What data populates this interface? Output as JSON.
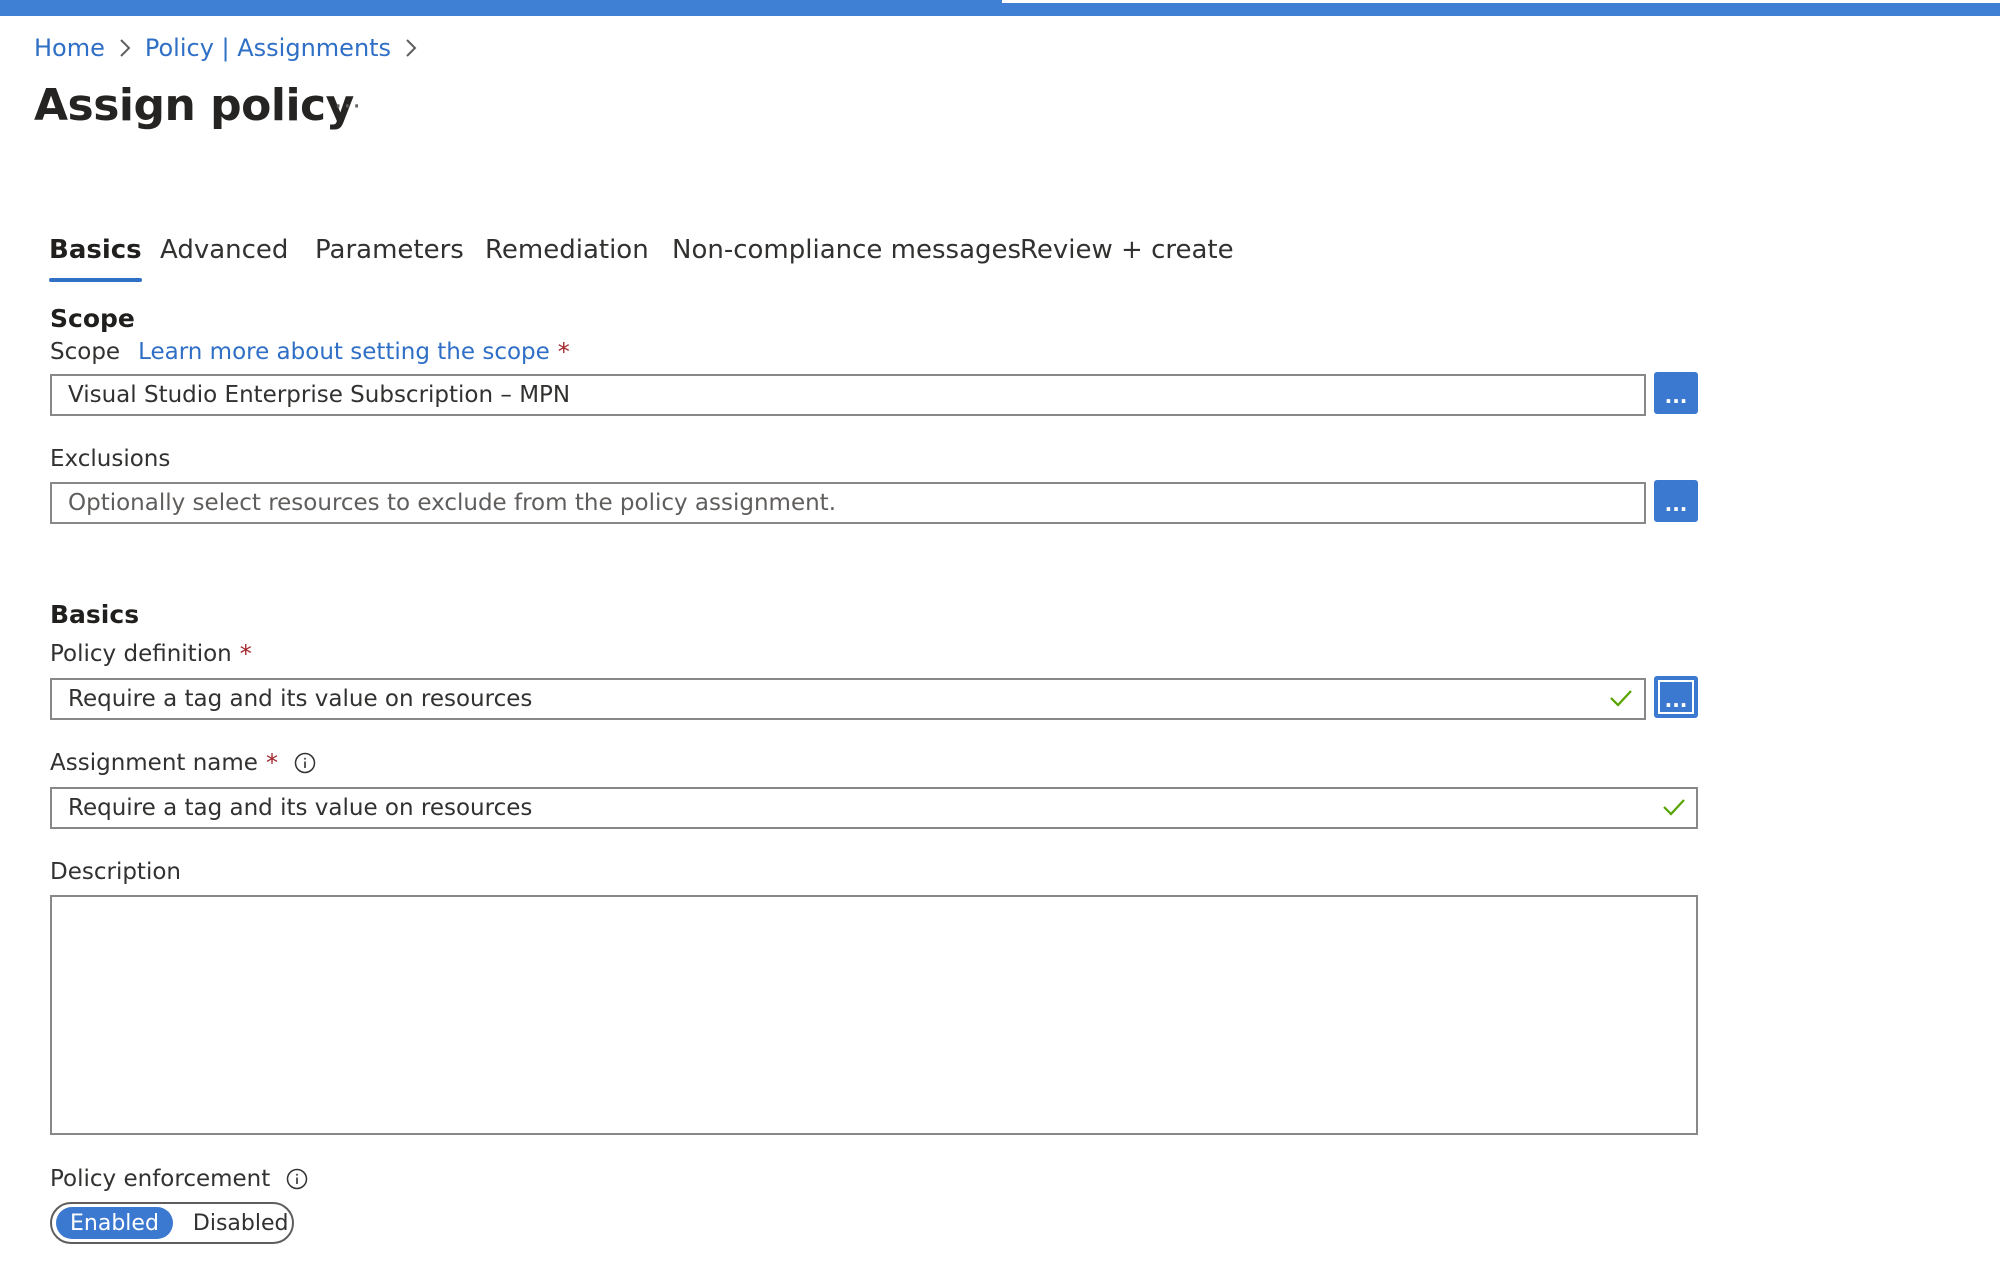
{
  "breadcrumb": {
    "home": "Home",
    "parent": "Policy | Assignments"
  },
  "page": {
    "title": "Assign policy",
    "more": "···"
  },
  "tabs": [
    {
      "label": "Basics",
      "active": true
    },
    {
      "label": "Advanced"
    },
    {
      "label": "Parameters"
    },
    {
      "label": "Remediation"
    },
    {
      "label": "Non-compliance messages"
    },
    {
      "label": "Review + create"
    }
  ],
  "scope_section": {
    "heading": "Scope",
    "scope_label": "Scope",
    "scope_link": "Learn more about setting the scope",
    "required_mark": "*",
    "scope_value": "Visual Studio Enterprise Subscription – MPN",
    "exclusions_label": "Exclusions",
    "exclusions_placeholder": "Optionally select resources to exclude from the policy assignment.",
    "browse_label": "..."
  },
  "basics_section": {
    "heading": "Basics",
    "policy_definition_label": "Policy definition",
    "policy_definition_value": "Require a tag and its value on resources",
    "assignment_name_label": "Assignment name",
    "assignment_name_value": "Require a tag and its value on resources",
    "description_label": "Description",
    "description_value": "",
    "enforcement_label": "Policy enforcement",
    "enforcement_options": [
      "Enabled",
      "Disabled"
    ],
    "enforcement_selected": "Enabled"
  },
  "colors": {
    "accent": "#3b78d0",
    "link": "#2f6fc6",
    "required": "#a4262c",
    "valid": "#57a300"
  },
  "icons": [
    "chevron-right-icon",
    "checkmark-icon",
    "info-icon"
  ]
}
